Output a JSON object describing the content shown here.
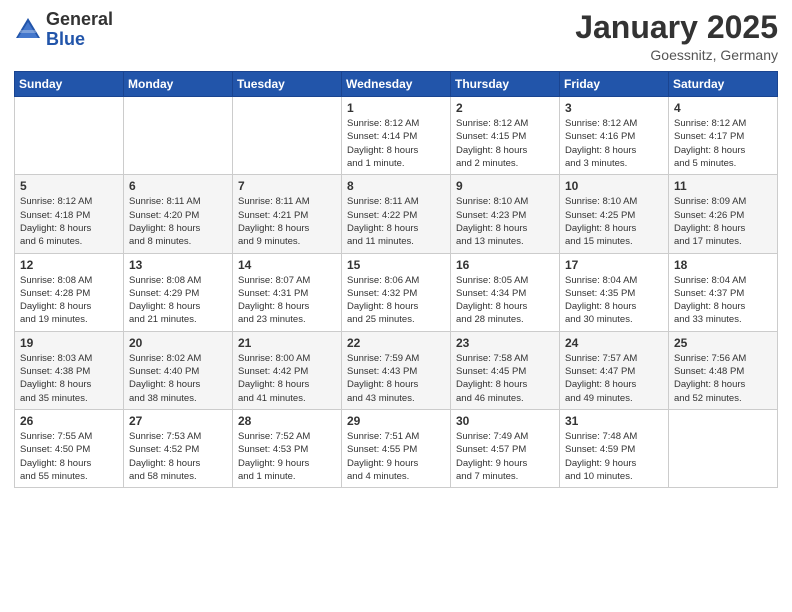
{
  "header": {
    "logo_general": "General",
    "logo_blue": "Blue",
    "month_title": "January 2025",
    "location": "Goessnitz, Germany"
  },
  "days_of_week": [
    "Sunday",
    "Monday",
    "Tuesday",
    "Wednesday",
    "Thursday",
    "Friday",
    "Saturday"
  ],
  "weeks": [
    [
      {
        "day": "",
        "info": ""
      },
      {
        "day": "",
        "info": ""
      },
      {
        "day": "",
        "info": ""
      },
      {
        "day": "1",
        "info": "Sunrise: 8:12 AM\nSunset: 4:14 PM\nDaylight: 8 hours\nand 1 minute."
      },
      {
        "day": "2",
        "info": "Sunrise: 8:12 AM\nSunset: 4:15 PM\nDaylight: 8 hours\nand 2 minutes."
      },
      {
        "day": "3",
        "info": "Sunrise: 8:12 AM\nSunset: 4:16 PM\nDaylight: 8 hours\nand 3 minutes."
      },
      {
        "day": "4",
        "info": "Sunrise: 8:12 AM\nSunset: 4:17 PM\nDaylight: 8 hours\nand 5 minutes."
      }
    ],
    [
      {
        "day": "5",
        "info": "Sunrise: 8:12 AM\nSunset: 4:18 PM\nDaylight: 8 hours\nand 6 minutes."
      },
      {
        "day": "6",
        "info": "Sunrise: 8:11 AM\nSunset: 4:20 PM\nDaylight: 8 hours\nand 8 minutes."
      },
      {
        "day": "7",
        "info": "Sunrise: 8:11 AM\nSunset: 4:21 PM\nDaylight: 8 hours\nand 9 minutes."
      },
      {
        "day": "8",
        "info": "Sunrise: 8:11 AM\nSunset: 4:22 PM\nDaylight: 8 hours\nand 11 minutes."
      },
      {
        "day": "9",
        "info": "Sunrise: 8:10 AM\nSunset: 4:23 PM\nDaylight: 8 hours\nand 13 minutes."
      },
      {
        "day": "10",
        "info": "Sunrise: 8:10 AM\nSunset: 4:25 PM\nDaylight: 8 hours\nand 15 minutes."
      },
      {
        "day": "11",
        "info": "Sunrise: 8:09 AM\nSunset: 4:26 PM\nDaylight: 8 hours\nand 17 minutes."
      }
    ],
    [
      {
        "day": "12",
        "info": "Sunrise: 8:08 AM\nSunset: 4:28 PM\nDaylight: 8 hours\nand 19 minutes."
      },
      {
        "day": "13",
        "info": "Sunrise: 8:08 AM\nSunset: 4:29 PM\nDaylight: 8 hours\nand 21 minutes."
      },
      {
        "day": "14",
        "info": "Sunrise: 8:07 AM\nSunset: 4:31 PM\nDaylight: 8 hours\nand 23 minutes."
      },
      {
        "day": "15",
        "info": "Sunrise: 8:06 AM\nSunset: 4:32 PM\nDaylight: 8 hours\nand 25 minutes."
      },
      {
        "day": "16",
        "info": "Sunrise: 8:05 AM\nSunset: 4:34 PM\nDaylight: 8 hours\nand 28 minutes."
      },
      {
        "day": "17",
        "info": "Sunrise: 8:04 AM\nSunset: 4:35 PM\nDaylight: 8 hours\nand 30 minutes."
      },
      {
        "day": "18",
        "info": "Sunrise: 8:04 AM\nSunset: 4:37 PM\nDaylight: 8 hours\nand 33 minutes."
      }
    ],
    [
      {
        "day": "19",
        "info": "Sunrise: 8:03 AM\nSunset: 4:38 PM\nDaylight: 8 hours\nand 35 minutes."
      },
      {
        "day": "20",
        "info": "Sunrise: 8:02 AM\nSunset: 4:40 PM\nDaylight: 8 hours\nand 38 minutes."
      },
      {
        "day": "21",
        "info": "Sunrise: 8:00 AM\nSunset: 4:42 PM\nDaylight: 8 hours\nand 41 minutes."
      },
      {
        "day": "22",
        "info": "Sunrise: 7:59 AM\nSunset: 4:43 PM\nDaylight: 8 hours\nand 43 minutes."
      },
      {
        "day": "23",
        "info": "Sunrise: 7:58 AM\nSunset: 4:45 PM\nDaylight: 8 hours\nand 46 minutes."
      },
      {
        "day": "24",
        "info": "Sunrise: 7:57 AM\nSunset: 4:47 PM\nDaylight: 8 hours\nand 49 minutes."
      },
      {
        "day": "25",
        "info": "Sunrise: 7:56 AM\nSunset: 4:48 PM\nDaylight: 8 hours\nand 52 minutes."
      }
    ],
    [
      {
        "day": "26",
        "info": "Sunrise: 7:55 AM\nSunset: 4:50 PM\nDaylight: 8 hours\nand 55 minutes."
      },
      {
        "day": "27",
        "info": "Sunrise: 7:53 AM\nSunset: 4:52 PM\nDaylight: 8 hours\nand 58 minutes."
      },
      {
        "day": "28",
        "info": "Sunrise: 7:52 AM\nSunset: 4:53 PM\nDaylight: 9 hours\nand 1 minute."
      },
      {
        "day": "29",
        "info": "Sunrise: 7:51 AM\nSunset: 4:55 PM\nDaylight: 9 hours\nand 4 minutes."
      },
      {
        "day": "30",
        "info": "Sunrise: 7:49 AM\nSunset: 4:57 PM\nDaylight: 9 hours\nand 7 minutes."
      },
      {
        "day": "31",
        "info": "Sunrise: 7:48 AM\nSunset: 4:59 PM\nDaylight: 9 hours\nand 10 minutes."
      },
      {
        "day": "",
        "info": ""
      }
    ]
  ]
}
